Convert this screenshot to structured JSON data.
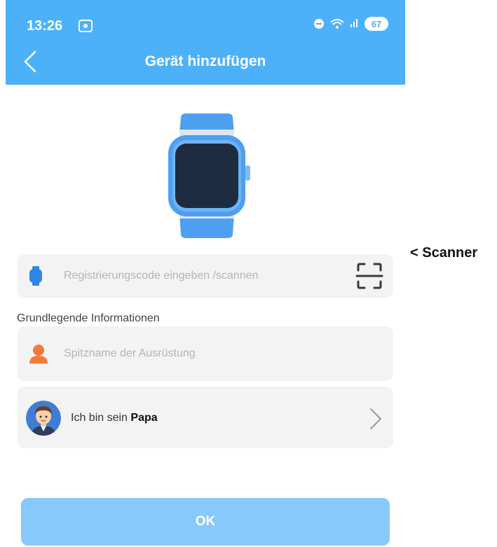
{
  "status_bar": {
    "time": "13:26",
    "battery": "67"
  },
  "header": {
    "title": "Gerät hinzufügen"
  },
  "registration": {
    "placeholder": "Registrierungscode eingeben /scannen"
  },
  "basic_info": {
    "label": "Grundlegende Informationen"
  },
  "nickname": {
    "placeholder": "Spitzname der Ausrüstung"
  },
  "relation": {
    "prefix": "Ich bin sein ",
    "value": "Papa"
  },
  "ok_button": {
    "label": "OK"
  },
  "annotation": {
    "text": "< Scanner"
  },
  "colors": {
    "header": "#4db1f9",
    "ok_button": "#88c9fb",
    "card": "#f3f3f3",
    "watch_blue": "#4f9ff0",
    "person_orange": "#f47a3a"
  },
  "icons": [
    "back-arrow-icon",
    "wifi-icon",
    "dnd-icon",
    "smartwatch-icon",
    "scan-icon",
    "person-icon",
    "avatar",
    "chevron-right-icon"
  ]
}
